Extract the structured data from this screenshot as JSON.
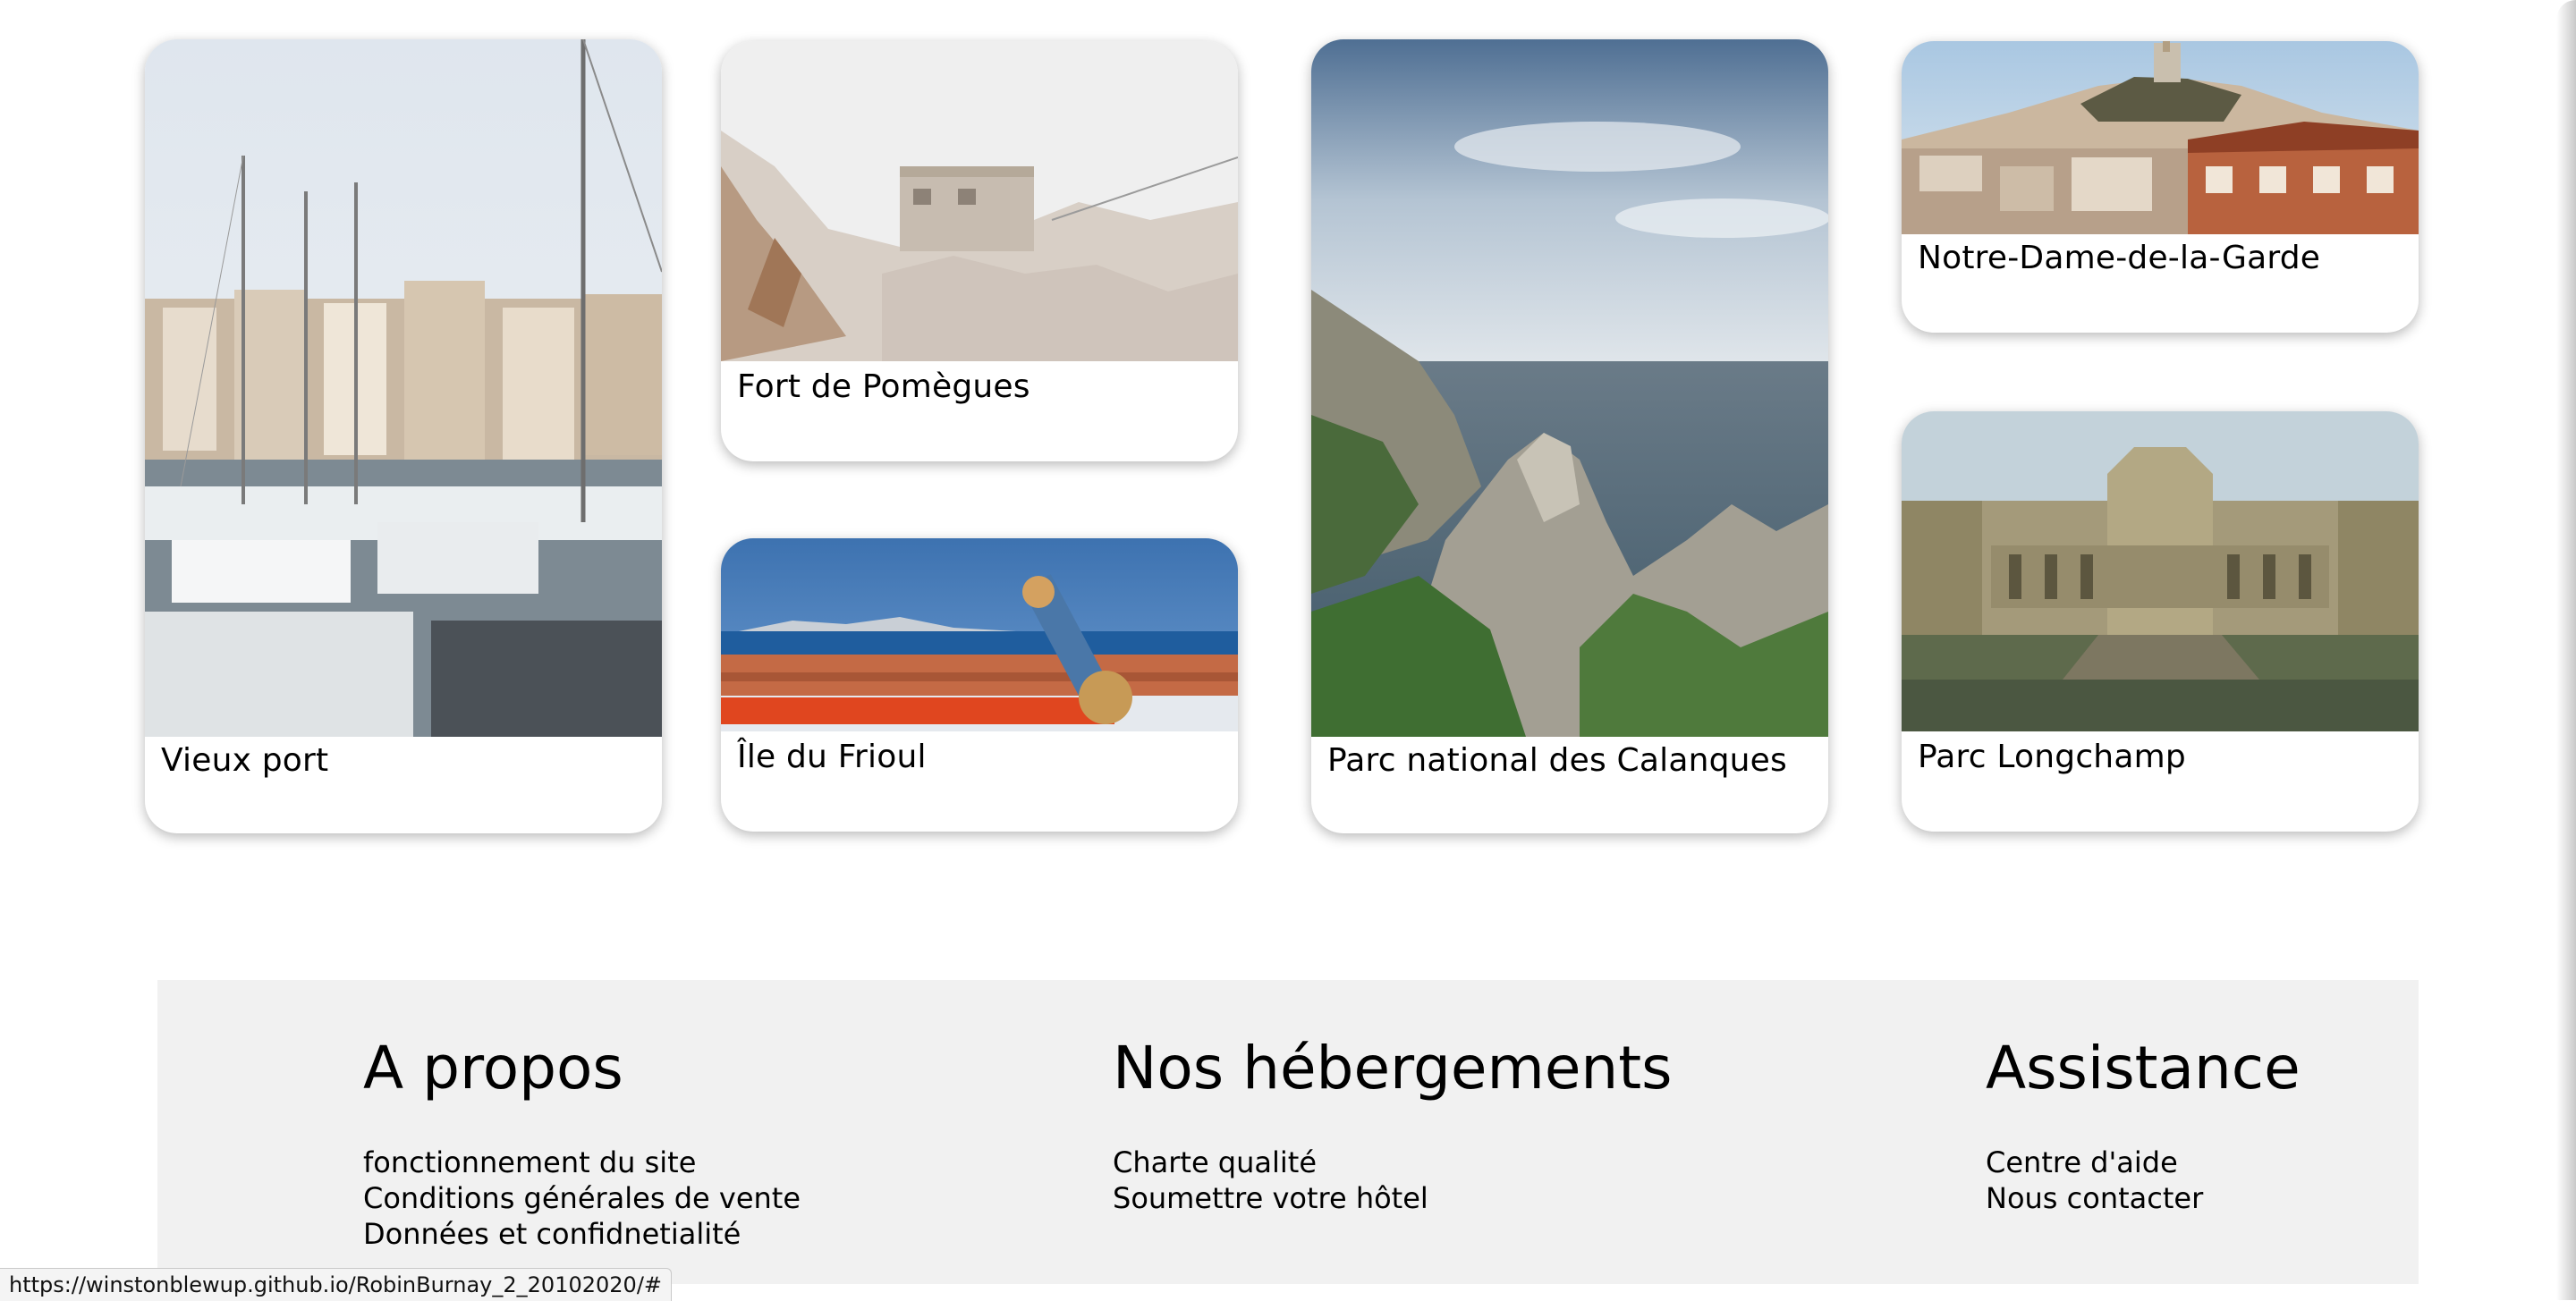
{
  "cards": [
    {
      "id": "vieux-port",
      "label": "Vieux port"
    },
    {
      "id": "fort-pomegues",
      "label": "Fort de Pomègues"
    },
    {
      "id": "ile-frioul",
      "label": "Île du Frioul"
    },
    {
      "id": "calanques",
      "label": "Parc national des Calanques"
    },
    {
      "id": "notre-dame",
      "label": "Notre-Dame-de-la-Garde"
    },
    {
      "id": "longchamp",
      "label": "Parc Longchamp"
    }
  ],
  "footer": {
    "about": {
      "title": "A propos",
      "links": [
        "fonctionnement du site",
        "Conditions générales de vente",
        "Données et confidnetialité"
      ]
    },
    "accommodations": {
      "title": "Nos hébergements",
      "links": [
        "Charte qualité",
        "Soumettre votre hôtel"
      ]
    },
    "support": {
      "title": "Assistance",
      "links": [
        "Centre d'aide",
        "Nous contacter"
      ]
    },
    "background": "#f1f1f1"
  },
  "status_bar": {
    "url": "https://winstonblewup.github.io/RobinBurnay_2_20102020/#"
  }
}
